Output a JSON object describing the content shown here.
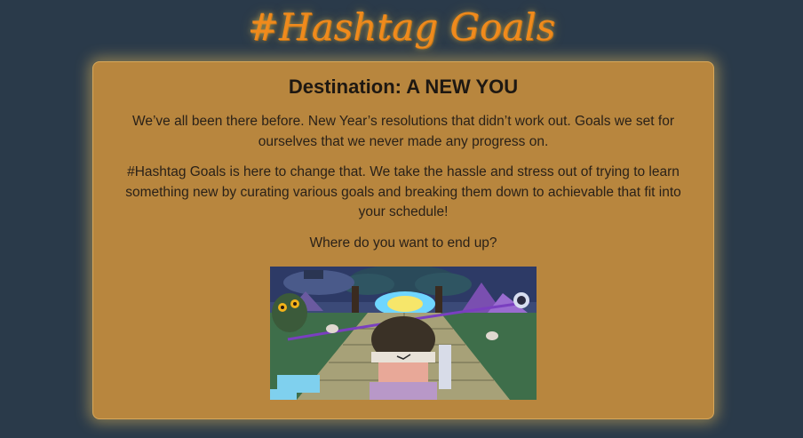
{
  "header": {
    "title": "#Hashtag Goals"
  },
  "intro": {
    "heading": "Destination: A NEW YOU",
    "paragraph_1": "We’ve all been there before. New Year’s resolutions that didn’t work out. Goals we set for ourselves that we never made any progress on.",
    "paragraph_2": "#Hashtag Goals is here to change that. We take the hassle and stress out of trying to learn something new by curating various goals and breaking them down to achievable that fit into your schedule!",
    "question": "Where do you want to end up?"
  },
  "colors": {
    "page_background": "#2a3a4a",
    "card_background": "#b8863e",
    "title_orange": "#f08a1c"
  }
}
